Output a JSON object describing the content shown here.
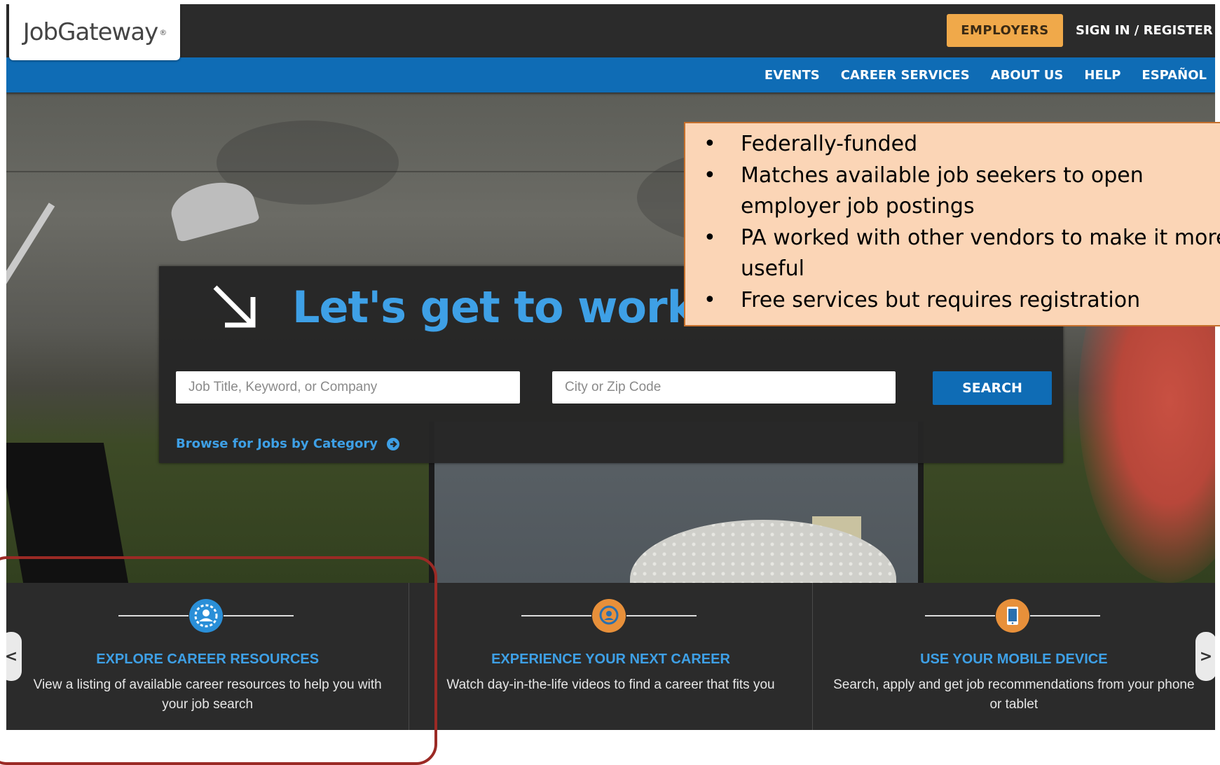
{
  "header": {
    "logo_text": "JobGateway",
    "logo_mark": "®",
    "employers_label": "EMPLOYERS",
    "signin_label": "SIGN IN / REGISTER"
  },
  "nav": {
    "items": [
      {
        "label": "EVENTS"
      },
      {
        "label": "CAREER SERVICES"
      },
      {
        "label": "ABOUT US"
      },
      {
        "label": "HELP"
      },
      {
        "label": "ESPAÑOL"
      }
    ]
  },
  "search": {
    "headline": "Let's get to work.",
    "keyword_placeholder": "Job Title, Keyword, or Company",
    "location_placeholder": "City or Zip Code",
    "search_label": "SEARCH",
    "browse_label": "Browse for Jobs by Category"
  },
  "callout": {
    "bullet": "•",
    "lines": [
      {
        "bullet": true,
        "text": "Federally-funded"
      },
      {
        "bullet": true,
        "text": "Matches available job seekers to open"
      },
      {
        "bullet": false,
        "text": "employer job postings"
      },
      {
        "bullet": true,
        "text": "PA worked with other vendors to make it more"
      },
      {
        "bullet": false,
        "text": "useful"
      },
      {
        "bullet": true,
        "text": "Free services but requires registration"
      }
    ]
  },
  "cards": [
    {
      "title": "EXPLORE CAREER RESOURCES",
      "desc": "View a listing of available career resources to help you with your job search",
      "icon": "career-resources-icon",
      "color": "#2a8fd8"
    },
    {
      "title": "EXPERIENCE YOUR NEXT CAREER",
      "desc": "Watch day-in-the-life videos to find a career that fits you",
      "icon": "video-career-icon",
      "color": "#e8903a"
    },
    {
      "title": "USE YOUR MOBILE DEVICE",
      "desc": "Search, apply and get job recommendations from your phone or tablet",
      "icon": "mobile-device-icon",
      "color": "#e8903a"
    }
  ],
  "carousel": {
    "prev_label": "<",
    "next_label": ">"
  },
  "colors": {
    "accent_blue": "#0f6cb5",
    "headline_blue": "#3ea0e6",
    "employers_orange": "#f0a94a",
    "callout_bg": "#fbd5b6",
    "highlight_red": "#9b2a25"
  }
}
